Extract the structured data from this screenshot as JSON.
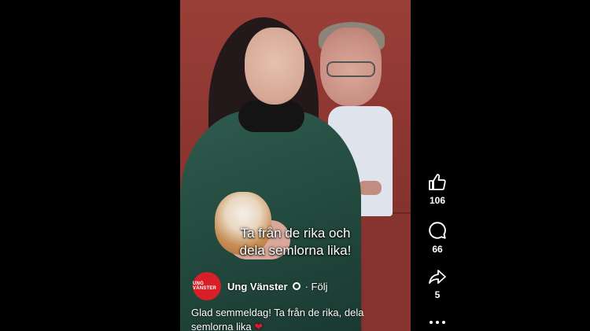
{
  "video": {
    "subtitle_line1": "Ta från de rika och",
    "subtitle_line2": "dela semlorna lika!"
  },
  "author": {
    "name": "Ung Vänster",
    "avatar_text": "UNG VÄNSTER",
    "follow_label": "· Följ"
  },
  "caption": {
    "text": "Glad semmeldag! Ta från de rika, dela semlorna lika",
    "emoji": "❤"
  },
  "actions": {
    "like_count": "106",
    "comment_count": "66",
    "share_count": "5"
  },
  "icons": {
    "like": "thumbs-up-icon",
    "comment": "comment-icon",
    "share": "share-icon",
    "more": "more-icon",
    "verified": "verified-icon"
  },
  "colors": {
    "avatar_red": "#d81e27",
    "heart_red": "#e0162b"
  }
}
